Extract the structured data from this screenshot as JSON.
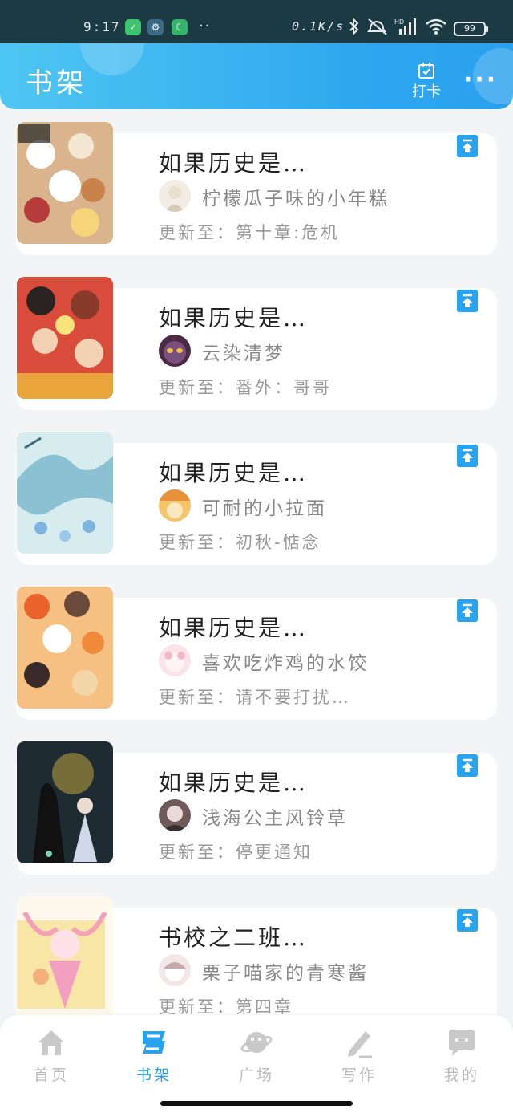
{
  "status_bar": {
    "time": "9:17",
    "net_speed": "0.1K/s",
    "battery": "99",
    "more": "··"
  },
  "header": {
    "title": "书架",
    "checkin_label": "打卡",
    "more_label": "···"
  },
  "books": [
    {
      "title": "如果历史是…",
      "author": "柠檬瓜子味的小年糕",
      "update": "更新至：第十章:危机"
    },
    {
      "title": "如果历史是…",
      "author": "云染清梦",
      "update": "更新至：番外：哥哥"
    },
    {
      "title": "如果历史是…",
      "author": "可耐的小拉面",
      "update": "更新至：初秋-惦念"
    },
    {
      "title": "如果历史是…",
      "author": "喜欢吃炸鸡的水饺",
      "update": "更新至：请不要打扰…"
    },
    {
      "title": "如果历史是…",
      "author": "浅海公主风铃草",
      "update": "更新至：停更通知"
    },
    {
      "title": "书校之二班…",
      "author": "栗子喵家的青寒酱",
      "update": "更新至：第四章"
    }
  ],
  "nav": [
    {
      "label": "首页",
      "icon": "home-icon"
    },
    {
      "label": "书架",
      "icon": "bookshelf-icon",
      "active": true
    },
    {
      "label": "广场",
      "icon": "planet-icon"
    },
    {
      "label": "写作",
      "icon": "pen-icon"
    },
    {
      "label": "我的",
      "icon": "chat-bubble-icon"
    }
  ],
  "colors": {
    "accent": "#2aa3ee",
    "header_start": "#4fc6f2",
    "status_bg": "#1b3a44",
    "inactive": "#bbbbbb"
  }
}
